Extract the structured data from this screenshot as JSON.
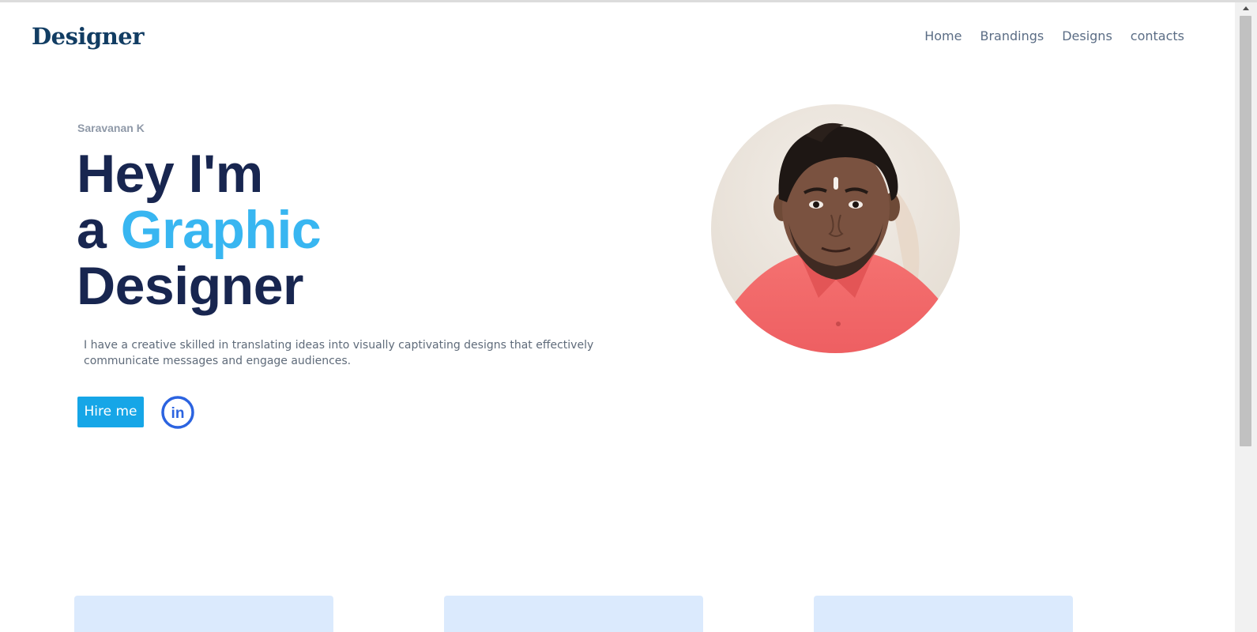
{
  "header": {
    "logo": "Designer",
    "nav": [
      {
        "label": "Home"
      },
      {
        "label": "Brandings"
      },
      {
        "label": "Designs"
      },
      {
        "label": "contacts"
      }
    ]
  },
  "hero": {
    "eyebrow": "Saravanan K",
    "headline": {
      "line1": "Hey I'm",
      "line2_prefix": "a ",
      "line2_accent": "Graphic",
      "line3": "Designer"
    },
    "intro": "I have a creative skilled in translating ideas into visually captivating designs that effectively communicate messages and engage audiences.",
    "hire_button": "Hire me",
    "social_icon": "linkedin-icon",
    "social_text": "in"
  },
  "portrait": {
    "icon": "profile-photo"
  },
  "colors": {
    "brand_navy": "#182650",
    "accent_blue": "#38b6f1",
    "button_blue": "#16a6e7",
    "linkedin_blue": "#2b63e0",
    "card_tint": "#dbeafd"
  }
}
